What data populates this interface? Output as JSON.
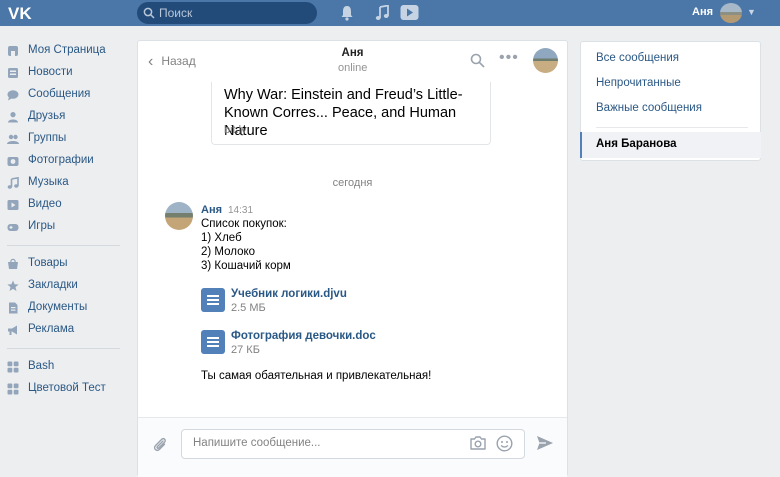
{
  "topbar": {
    "search_placeholder": "Поиск",
    "user_name": "Аня",
    "icons": [
      "vk-logo-icon",
      "search-icon",
      "bell-icon",
      "music-icon",
      "play-icon",
      "chevron-down-icon"
    ]
  },
  "leftnav": {
    "group1": [
      {
        "label": "Моя Страница",
        "icon": "home-icon"
      },
      {
        "label": "Новости",
        "icon": "news-icon"
      },
      {
        "label": "Сообщения",
        "icon": "messages-icon"
      },
      {
        "label": "Друзья",
        "icon": "friends-icon"
      },
      {
        "label": "Группы",
        "icon": "groups-icon"
      },
      {
        "label": "Фотографии",
        "icon": "photos-icon"
      },
      {
        "label": "Музыка",
        "icon": "music-icon"
      },
      {
        "label": "Видео",
        "icon": "video-icon"
      },
      {
        "label": "Игры",
        "icon": "games-icon"
      }
    ],
    "group2": [
      {
        "label": "Товары",
        "icon": "market-icon"
      },
      {
        "label": "Закладки",
        "icon": "star-icon"
      },
      {
        "label": "Документы",
        "icon": "documents-icon"
      },
      {
        "label": "Реклама",
        "icon": "ads-icon"
      }
    ],
    "group3": [
      {
        "label": "Bash",
        "icon": "app-icon"
      },
      {
        "label": "Цветовой Тест",
        "icon": "app-icon"
      }
    ]
  },
  "chat": {
    "back_label": "Назад",
    "title": "Аня",
    "status": "online",
    "link_card": {
      "title": "Why War: Einstein and Freud’s Little-Known Corres... Peace, and Human Nature",
      "host": "bit.ly"
    },
    "date_separator": "сегодня",
    "message": {
      "author": "Аня",
      "time": "14:31",
      "lines": [
        "Список покупок:",
        "1) Хлеб",
        "2) Молоко",
        "3) Кошачий корм"
      ],
      "documents": [
        {
          "name": "Учебник логики.djvu",
          "size": "2.5 МБ"
        },
        {
          "name": "Фотография девочки.doc",
          "size": "27 КБ"
        }
      ],
      "closing_text": "Ты самая обаятельная и привлекательная!"
    },
    "composer": {
      "placeholder": "Напишите сообщение..."
    }
  },
  "rightpanel": {
    "items": [
      "Все сообщения",
      "Непрочитанные",
      "Важные сообщения"
    ],
    "active_conversation": "Аня Баранова"
  },
  "colors": {
    "header_blue": "#4a76a8",
    "link_blue": "#2a5885",
    "accent": "#5181b8",
    "background": "#edeef0"
  }
}
